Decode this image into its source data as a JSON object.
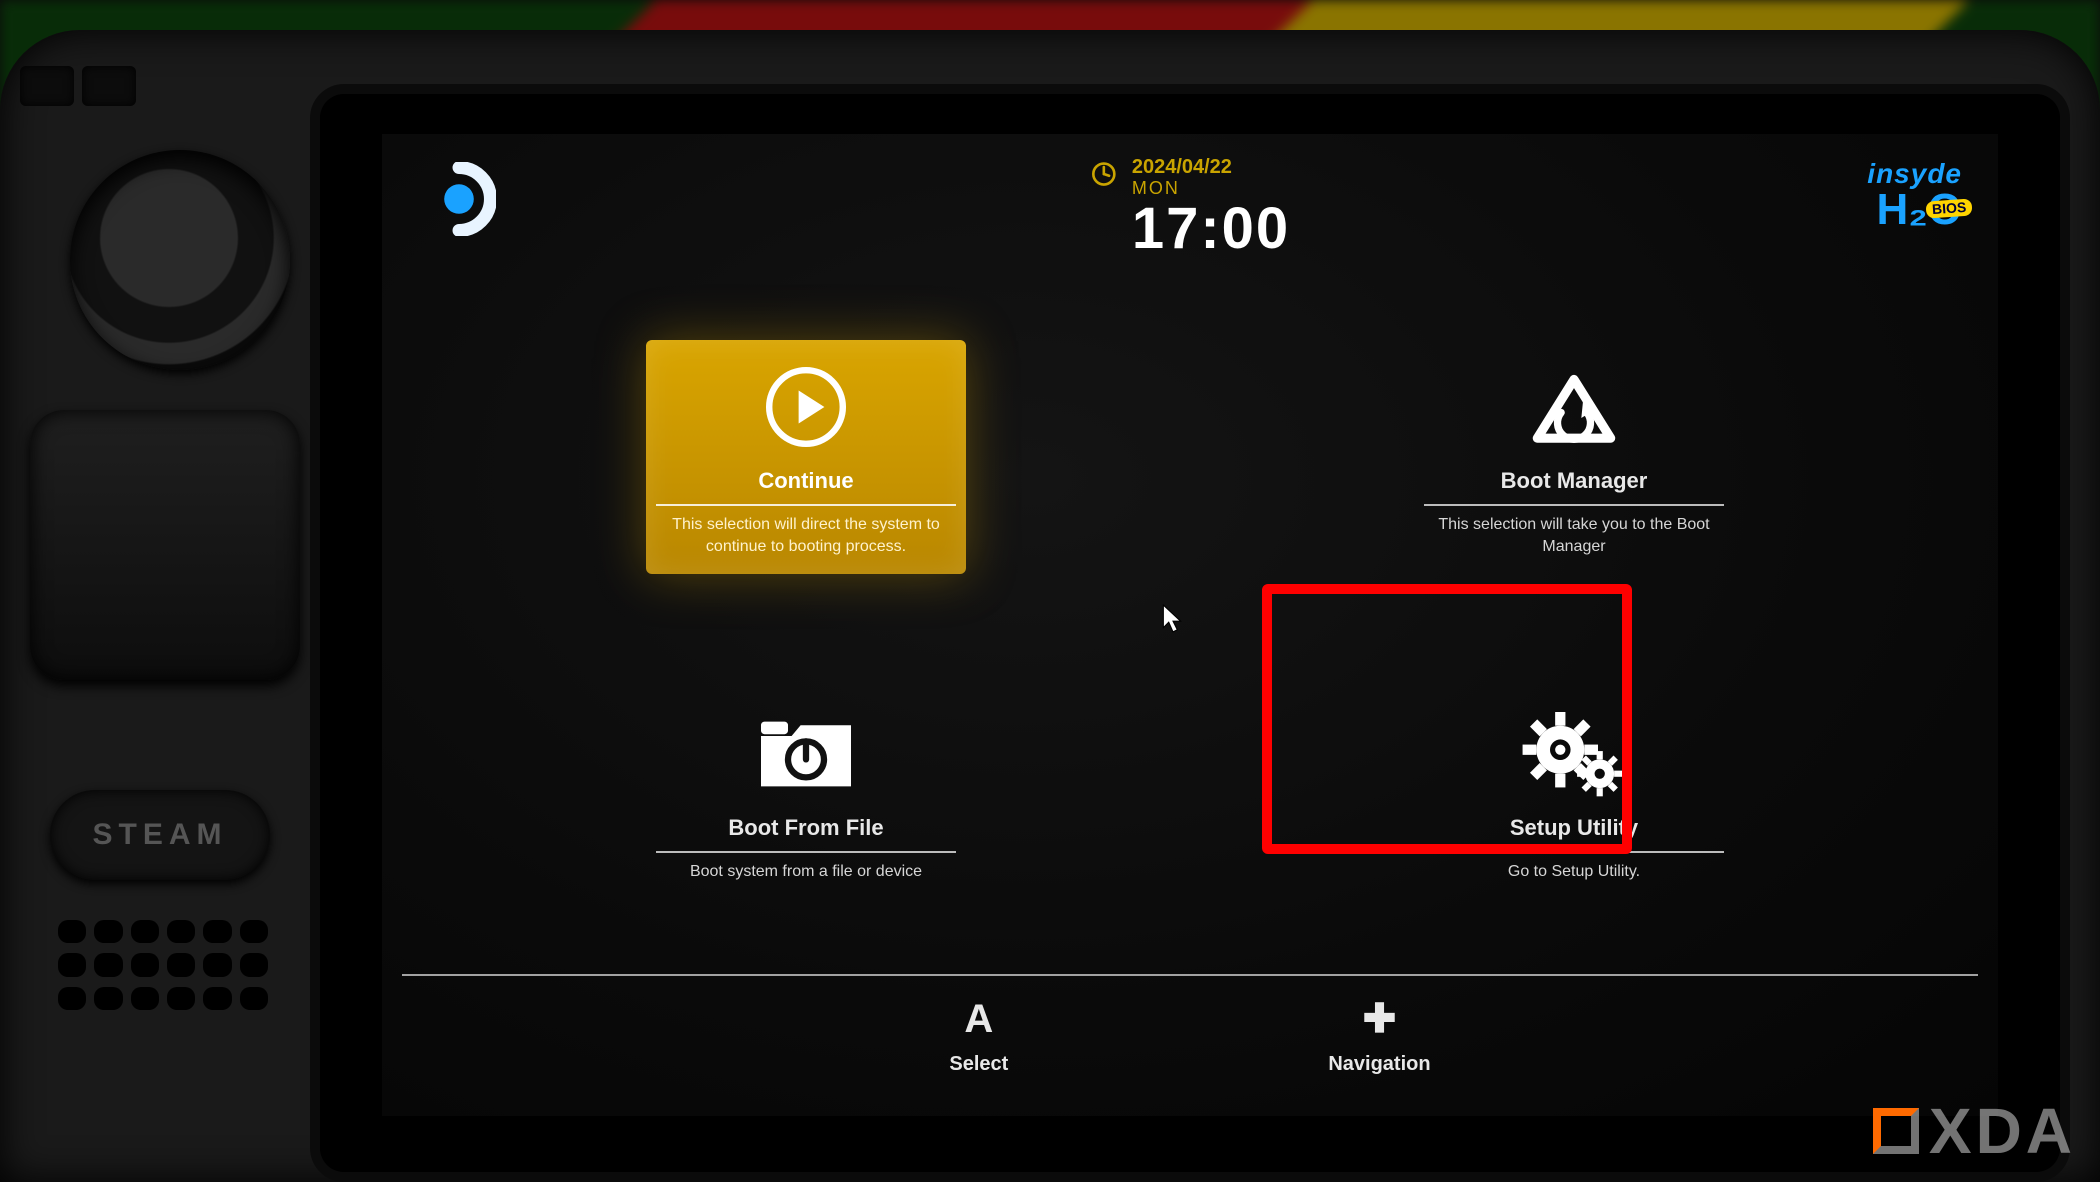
{
  "header": {
    "date": "2024/04/22",
    "day_of_week": "MON",
    "time": "17:00"
  },
  "branding": {
    "vendor_top": "insyde",
    "vendor_main": "H₂O",
    "vendor_badge": "BIOS"
  },
  "device": {
    "steam_button_label": "STEAM"
  },
  "tiles": [
    {
      "id": "continue",
      "title": "Continue",
      "description": "This selection will direct the system to continue to booting process.",
      "icon": "play-icon",
      "selected": true
    },
    {
      "id": "boot-manager",
      "title": "Boot Manager",
      "description": "This selection will take you to the Boot Manager",
      "icon": "recycle-icon",
      "selected": false
    },
    {
      "id": "boot-from-file",
      "title": "Boot From File",
      "description": "Boot system from a file or device",
      "icon": "folder-power-icon",
      "selected": false
    },
    {
      "id": "setup-utility",
      "title": "Setup Utility",
      "description": "Go to Setup Utility.",
      "icon": "gears-icon",
      "selected": false
    }
  ],
  "hints": {
    "select": {
      "glyph": "A",
      "label": "Select"
    },
    "navigation": {
      "glyph": "✚",
      "label": "Navigation"
    }
  },
  "annotation": {
    "target_tile": "setup-utility"
  },
  "watermark": {
    "text": "XDA"
  }
}
